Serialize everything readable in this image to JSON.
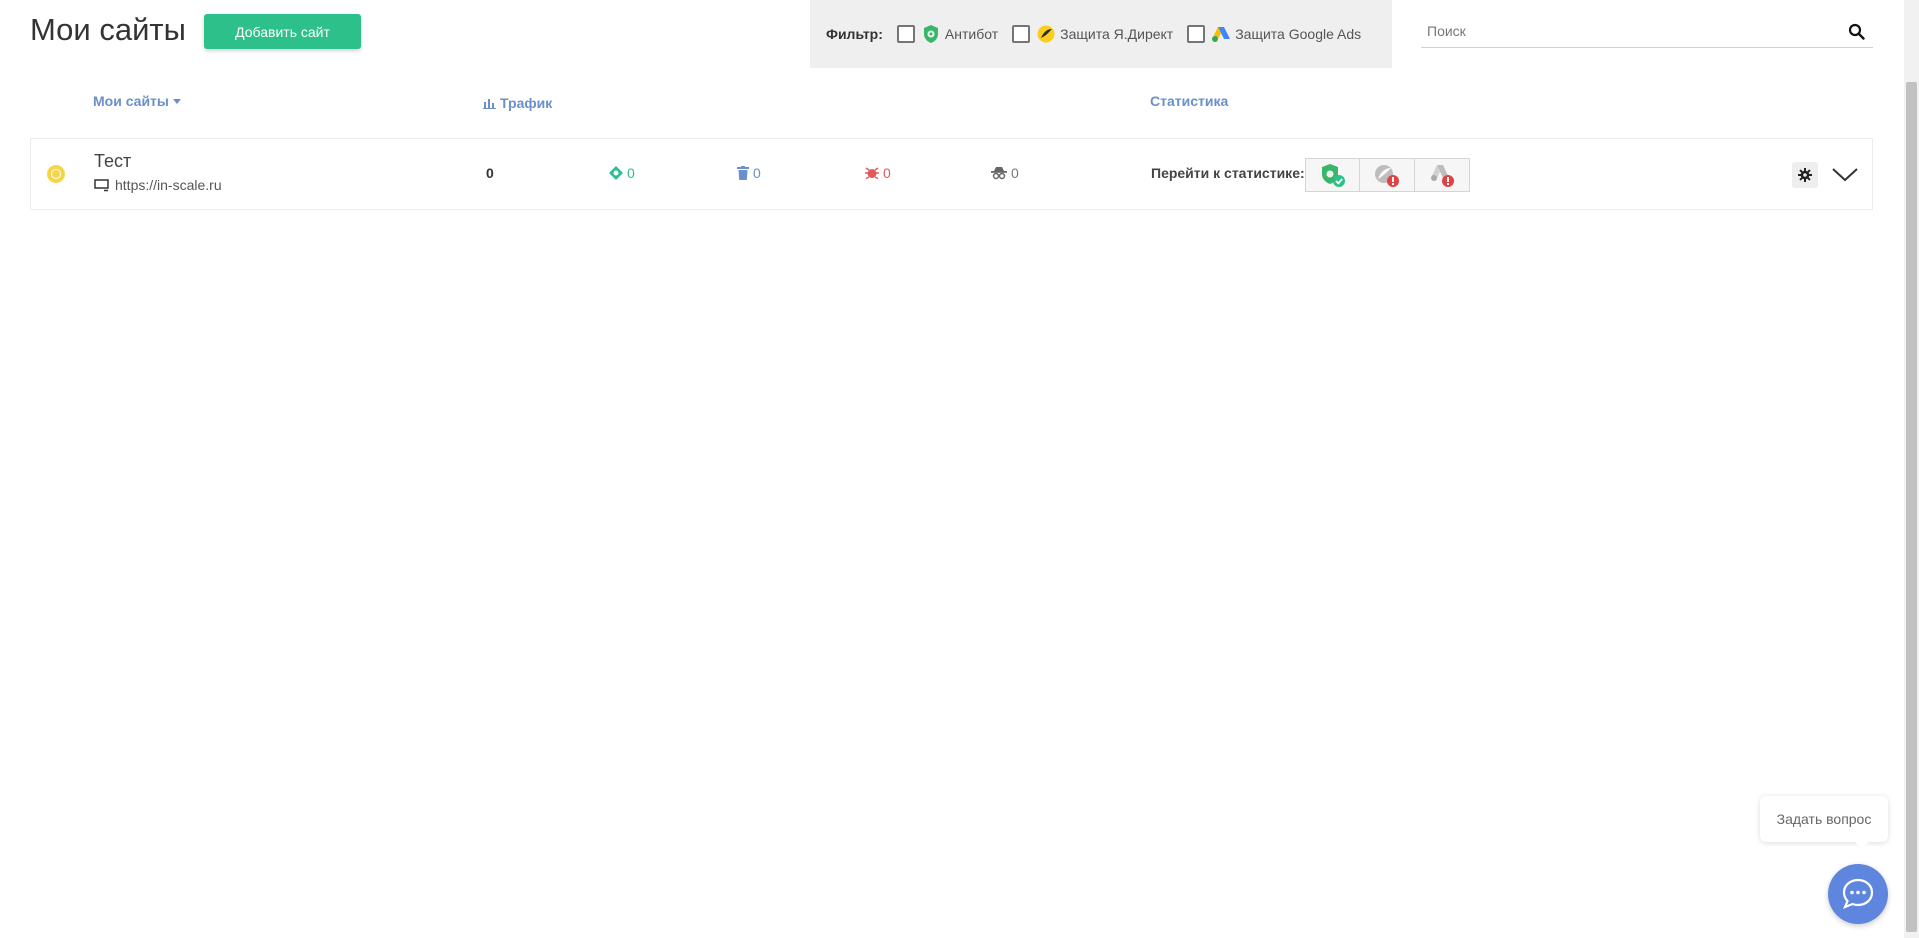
{
  "header": {
    "title": "Мои сайты",
    "add_site_label": "Добавить сайт"
  },
  "filter": {
    "label": "Фильтр:",
    "options": [
      {
        "label": "Антибот",
        "icon": "antibot-shield-icon",
        "checked": false
      },
      {
        "label": "Защита Я.Директ",
        "icon": "yandex-direct-icon",
        "checked": false
      },
      {
        "label": "Защита Google Ads",
        "icon": "google-ads-icon",
        "checked": false
      }
    ]
  },
  "search": {
    "placeholder": "Поиск"
  },
  "columns": {
    "sites": "Мои сайты",
    "traffic": "Трафик",
    "stats": "Статистика"
  },
  "sites": [
    {
      "name": "Тест",
      "url": "https://in-scale.ru",
      "status_color": "#f5d64a",
      "traffic_total": "0",
      "metrics": {
        "green": "0",
        "blue": "0",
        "red": "0",
        "gray": "0"
      },
      "goto_stats_label": "Перейти к статистике:"
    }
  ],
  "chat": {
    "tooltip": "Задать вопрос"
  },
  "colors": {
    "accent_green": "#2dc08a",
    "link_blue": "#6a8fcb",
    "chat_blue": "#5e86de",
    "error_red": "#e05a5a"
  }
}
